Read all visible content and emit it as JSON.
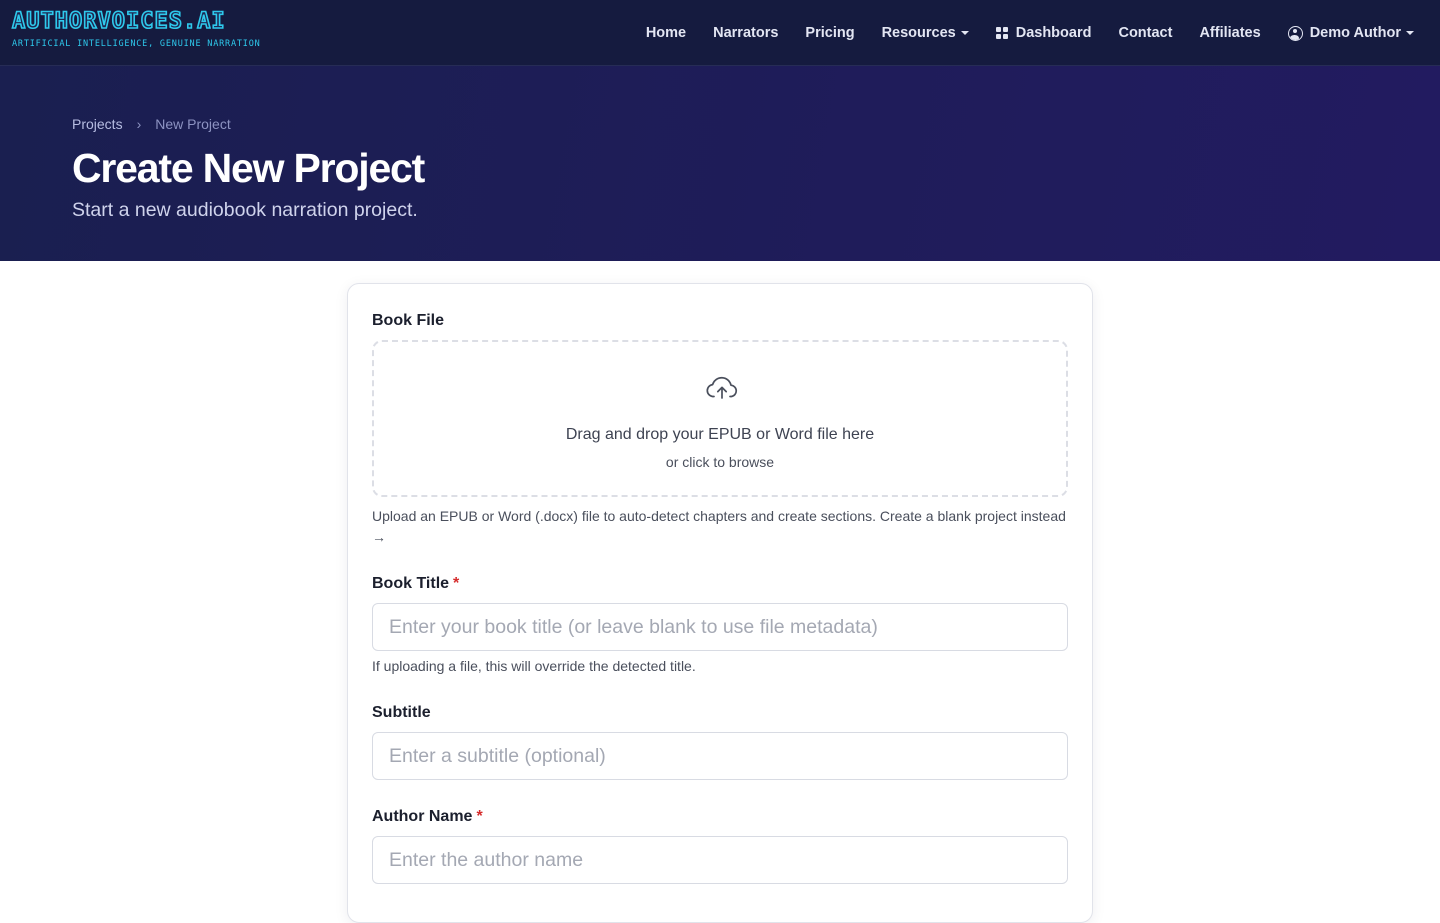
{
  "brand": {
    "logo_text": "AUTHORVOICES.AI",
    "tagline": "ARTIFICIAL INTELLIGENCE, GENUINE NARRATION"
  },
  "nav": {
    "home": "Home",
    "narrators": "Narrators",
    "pricing": "Pricing",
    "resources": "Resources",
    "dashboard": "Dashboard",
    "contact": "Contact",
    "affiliates": "Affiliates",
    "user": "Demo Author"
  },
  "breadcrumb": {
    "parent": "Projects",
    "separator": "›",
    "current": "New Project"
  },
  "hero": {
    "title": "Create New Project",
    "subtitle": "Start a new audiobook narration project."
  },
  "form": {
    "book_file": {
      "label": "Book File",
      "drop_text": "Drag and drop your EPUB or Word file here",
      "browse_text": "or click to browse",
      "help_text": "Upload an EPUB or Word (.docx) file to auto-detect chapters and create sections.",
      "blank_link": "Create a blank project instead →"
    },
    "book_title": {
      "label": "Book Title",
      "required_mark": "*",
      "placeholder": "Enter your book title (or leave blank to use file metadata)",
      "value": "",
      "help_text": "If uploading a file, this will override the detected title."
    },
    "subtitle": {
      "label": "Subtitle",
      "placeholder": "Enter a subtitle (optional)",
      "value": ""
    },
    "author_name": {
      "label": "Author Name",
      "required_mark": "*",
      "placeholder": "Enter the author name",
      "value": ""
    }
  },
  "colors": {
    "nav_bg": "#151b3f",
    "hero_bg": "#1f1c5a",
    "logo_accent": "#2ec9ec",
    "required": "#d62c2c"
  },
  "icons": {
    "dashboard": "grid-icon",
    "user": "user-circle-icon",
    "upload": "cloud-upload-icon",
    "dropdown": "caret-down-icon"
  }
}
